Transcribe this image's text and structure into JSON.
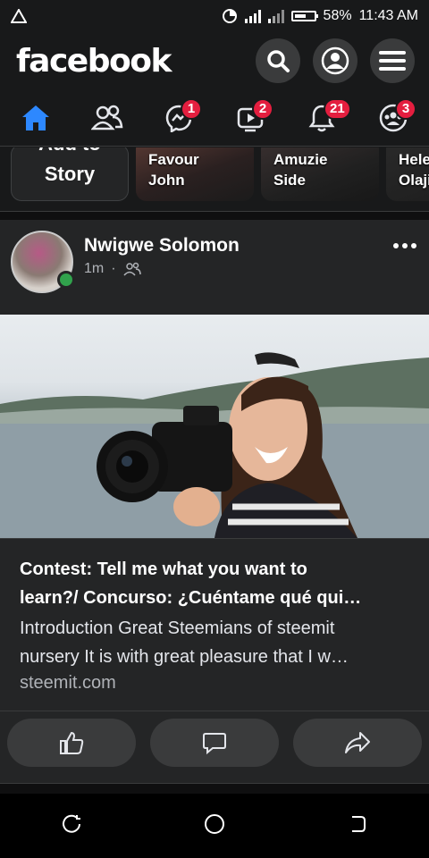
{
  "status_bar": {
    "battery": "58%",
    "time": "11:43 AM"
  },
  "header": {
    "logo": "facebook",
    "icons": [
      "search-icon",
      "profile-icon",
      "menu-icon"
    ]
  },
  "nav_tabs": [
    {
      "name": "home",
      "icon": "home-icon",
      "active": true,
      "badge": ""
    },
    {
      "name": "friends",
      "icon": "friends-icon",
      "badge": ""
    },
    {
      "name": "messenger",
      "icon": "messenger-icon",
      "badge": "1"
    },
    {
      "name": "watch",
      "icon": "video-icon",
      "badge": "2"
    },
    {
      "name": "notifications",
      "icon": "bell-icon",
      "badge": "21"
    },
    {
      "name": "groups",
      "icon": "groups-icon",
      "badge": "3"
    }
  ],
  "stories": {
    "add_line1": "Add to",
    "add_line2": "Story",
    "cards": [
      {
        "line1": "Favour",
        "line2": "John"
      },
      {
        "line1": "Amuzie",
        "line2": "Side"
      },
      {
        "line1": "Hele",
        "line2": "Olaji"
      }
    ]
  },
  "post": {
    "author": "Nwigwe Solomon",
    "time": "1m",
    "audience_icon": "friends-icon",
    "link": {
      "title_line1": "Contest: Tell me what you want to",
      "title_line2": "learn?/ Concurso: ¿Cuéntame qué qui…",
      "desc_line1": "Introduction Great Steemians of steemit",
      "desc_line2": "nursery It is with great pleasure that I w…",
      "domain": "steemit.com"
    },
    "actions": [
      "like-icon",
      "comment-icon",
      "share-icon"
    ]
  },
  "colors": {
    "background": "#18191a",
    "card": "#242526",
    "accent": "#2d88ff",
    "badge": "#e41e3f",
    "online": "#31a24c"
  }
}
